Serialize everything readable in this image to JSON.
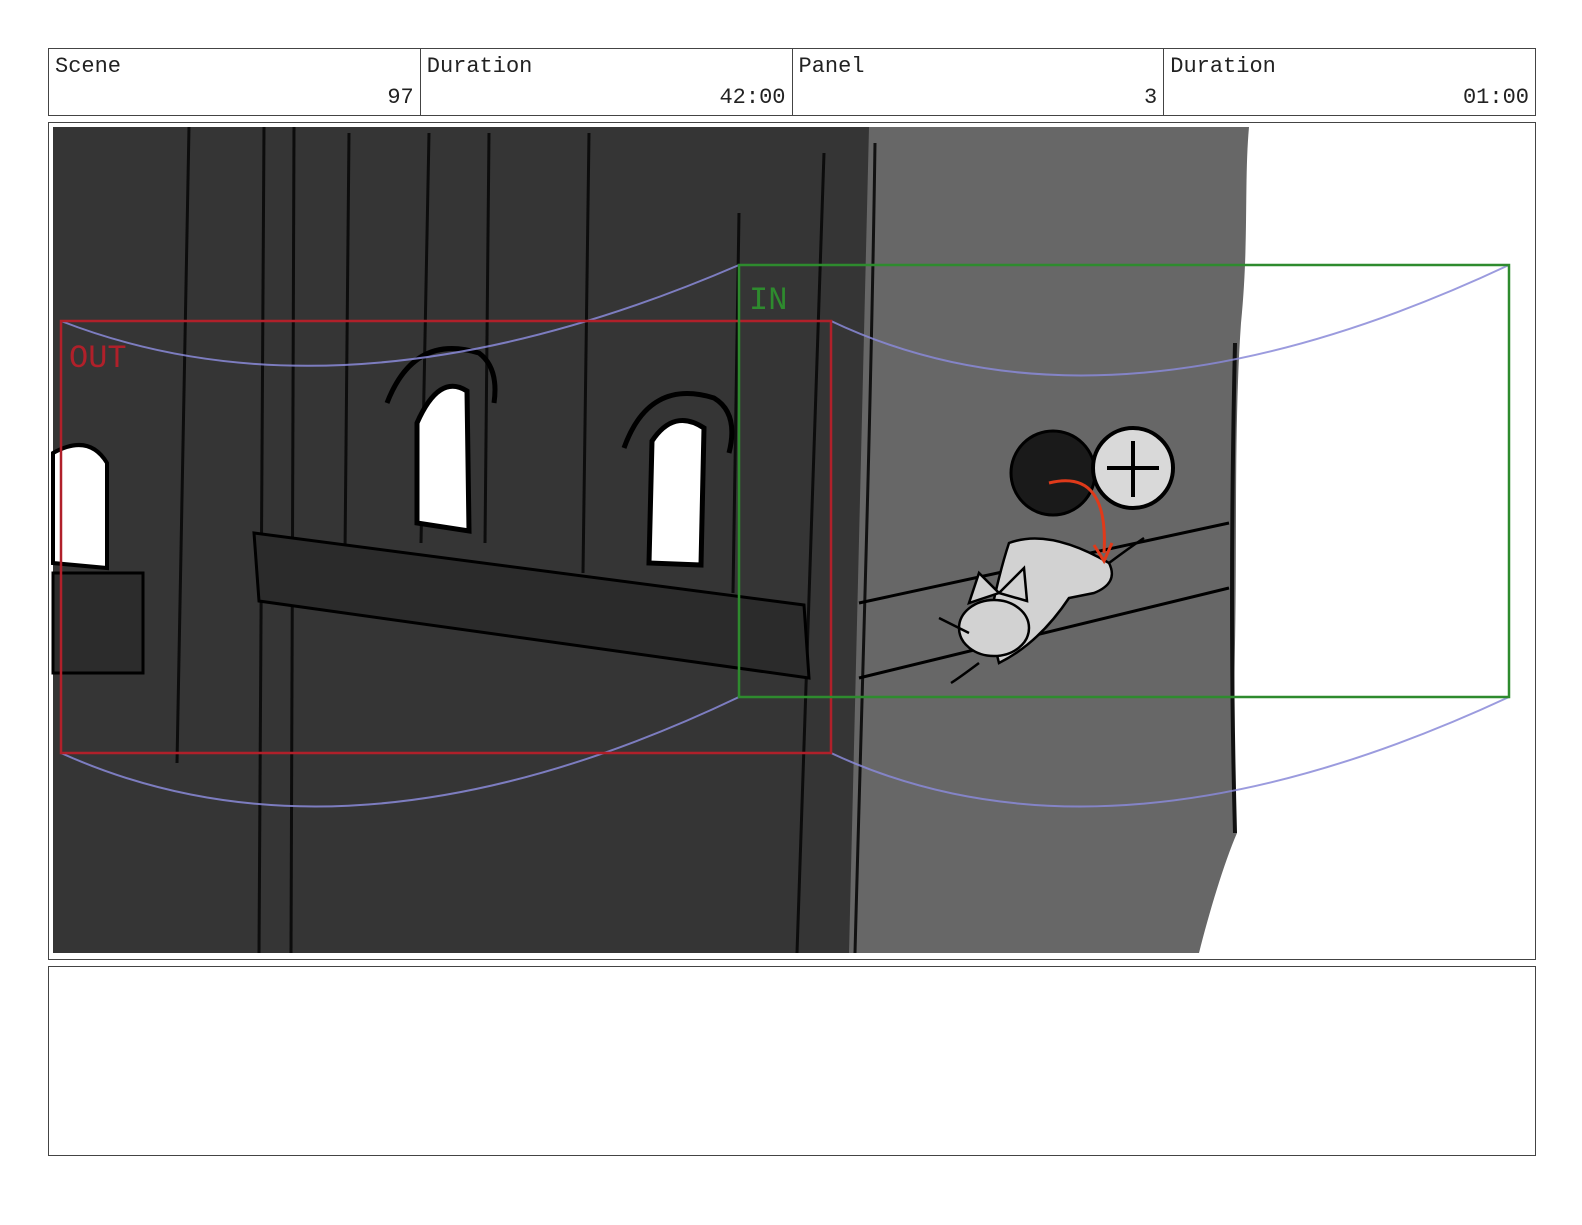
{
  "header": {
    "scene_label": "Scene",
    "scene_value": "97",
    "duration_label": "Duration",
    "duration_value": "42:00",
    "panel_label": "Panel",
    "panel_value": "3",
    "panel_duration_label": "Duration",
    "panel_duration_value": "01:00"
  },
  "panel": {
    "in_label": "IN",
    "out_label": "OUT",
    "in_color": "#2e8b2e",
    "out_color": "#b0202a",
    "motion_path_color": "#8a8ad8",
    "action_arrow_color": "#e03a1a"
  },
  "notes": {
    "text": ""
  }
}
